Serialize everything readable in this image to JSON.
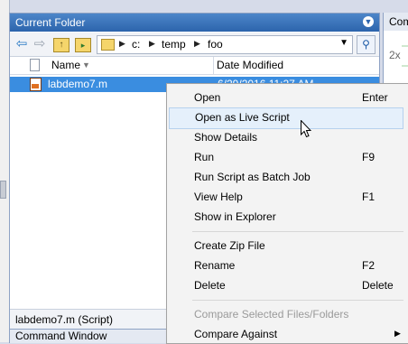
{
  "panel": {
    "title": "Current Folder"
  },
  "path": {
    "crumbs": [
      "c:",
      "temp",
      "foo"
    ]
  },
  "columns": {
    "name": "Name",
    "date": "Date Modified"
  },
  "file": {
    "name": "labdemo7.m",
    "date": "6/29/2016 11:27 AM"
  },
  "status": {
    "text": "labdemo7.m  (Script)"
  },
  "bottom_tab": {
    "label": "Command Window"
  },
  "right_panel": {
    "title": "Comm",
    "count": "2x"
  },
  "context_menu": {
    "items": [
      {
        "label": "Open",
        "shortcut": "Enter"
      },
      {
        "label": "Open as Live Script",
        "shortcut": ""
      },
      {
        "label": "Show Details",
        "shortcut": ""
      },
      {
        "label": "Run",
        "shortcut": "F9"
      },
      {
        "label": "Run Script as Batch Job",
        "shortcut": ""
      },
      {
        "label": "View Help",
        "shortcut": "F1"
      },
      {
        "label": "Show in Explorer",
        "shortcut": ""
      },
      {
        "label": "Create Zip File",
        "shortcut": ""
      },
      {
        "label": "Rename",
        "shortcut": "F2"
      },
      {
        "label": "Delete",
        "shortcut": "Delete"
      },
      {
        "label": "Compare Selected Files/Folders",
        "shortcut": ""
      },
      {
        "label": "Compare Against",
        "shortcut": ""
      }
    ]
  }
}
